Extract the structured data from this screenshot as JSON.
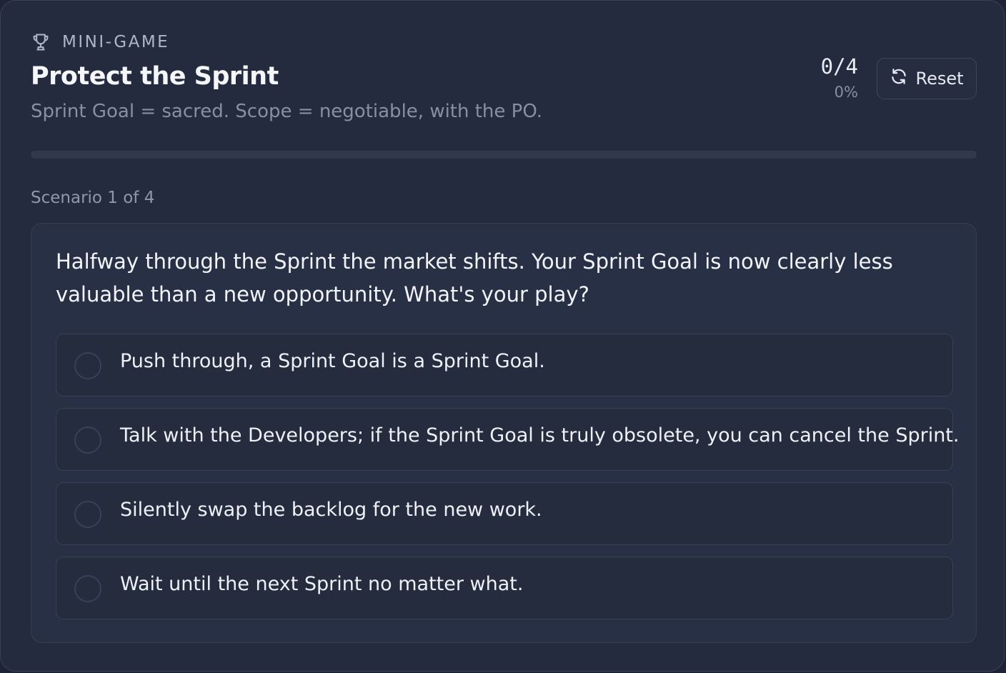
{
  "game": {
    "eyebrow": "MINI-GAME",
    "eyebrow_icon": "trophy-icon",
    "title": "Protect the Sprint",
    "subtitle": "Sprint Goal = sacred. Scope = negotiable, with the PO.",
    "score": "0/4",
    "score_percent": "0%",
    "progress_fraction": 0,
    "reset_label": "Reset",
    "reset_icon": "refresh-icon"
  },
  "scenario": {
    "counter": "Scenario 1 of 4",
    "question": "Halfway through the Sprint the market shifts. Your Sprint Goal is now clearly less valuable than a new opportunity. What's your play?",
    "options": [
      {
        "label": "Push through, a Sprint Goal is a Sprint Goal."
      },
      {
        "label": "Talk with the Developers; if the Sprint Goal is truly obsolete, you can cancel the Sprint."
      },
      {
        "label": "Silently swap the backlog for the new work."
      },
      {
        "label": "Wait until the next Sprint no matter what."
      }
    ]
  },
  "colors": {
    "background": "#1e2436",
    "card": "#242b3e",
    "accent": "#6b8cff",
    "text_primary": "#f4f6fa",
    "text_muted": "#8690a4"
  }
}
